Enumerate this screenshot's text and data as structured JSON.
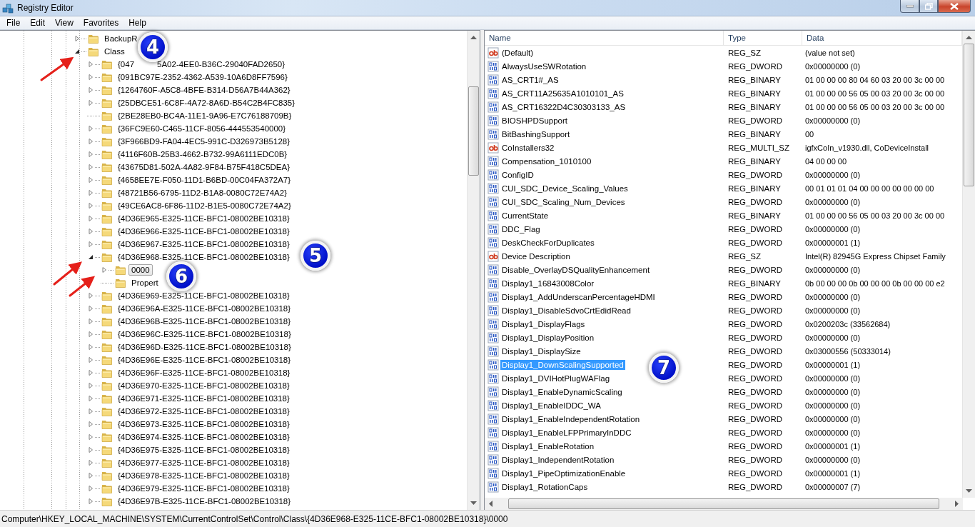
{
  "window": {
    "title": "Registry Editor"
  },
  "menu": [
    "File",
    "Edit",
    "View",
    "Favorites",
    "Help"
  ],
  "tree": {
    "items": [
      {
        "label": "BackupR",
        "has_children": true,
        "expanded": false,
        "selected": false
      },
      {
        "label": "Class",
        "has_children": true,
        "expanded": true,
        "selected": false,
        "children": [
          {
            "label": "{047",
            "label_after": "5A02-4EE0-B36C-29040FAD2650}",
            "has_children": true,
            "expanded": false,
            "selected": false
          },
          {
            "label": "{091BC97E-2352-4362-A539-10A6D8FF7596}",
            "has_children": true,
            "expanded": false,
            "selected": false
          },
          {
            "label": "{1264760F-A5C8-4BFE-B314-D56A7B44A362}",
            "has_children": true,
            "expanded": false,
            "selected": false
          },
          {
            "label": "{25DBCE51-6C8F-4A72-8A6D-B54C2B4FC835}",
            "has_children": true,
            "expanded": false,
            "selected": false
          },
          {
            "label": "{2BE28EB0-BC4A-11E1-9A96-E7C76188709B}",
            "has_children": false,
            "selected": false
          },
          {
            "label": "{36FC9E60-C465-11CF-8056-444553540000}",
            "has_children": true,
            "expanded": false,
            "selected": false
          },
          {
            "label": "{3F966BD9-FA04-4EC5-991C-D326973B5128}",
            "has_children": true,
            "expanded": false,
            "selected": false
          },
          {
            "label": "{4116F60B-25B3-4662-B732-99A6111EDC0B}",
            "has_children": true,
            "expanded": false,
            "selected": false
          },
          {
            "label": "{43675D81-502A-4A82-9F84-B75F418C5DEA}",
            "has_children": true,
            "expanded": false,
            "selected": false
          },
          {
            "label": "{4658EE7E-F050-11D1-B6BD-00C04FA372A7}",
            "has_children": true,
            "expanded": false,
            "selected": false
          },
          {
            "label": "{48721B56-6795-11D2-B1A8-0080C72E74A2}",
            "has_children": true,
            "expanded": false,
            "selected": false
          },
          {
            "label": "{49CE6AC8-6F86-11D2-B1E5-0080C72E74A2}",
            "has_children": true,
            "expanded": false,
            "selected": false
          },
          {
            "label": "{4D36E965-E325-11CE-BFC1-08002BE10318}",
            "has_children": true,
            "expanded": false,
            "selected": false
          },
          {
            "label": "{4D36E966-E325-11CE-BFC1-08002BE10318}",
            "has_children": true,
            "expanded": false,
            "selected": false
          },
          {
            "label": "{4D36E967-E325-11CE-BFC1-08002BE10318}",
            "has_children": true,
            "expanded": false,
            "selected": false
          },
          {
            "label": "{4D36E968-E325-11CE-BFC1-08002BE10318}",
            "has_children": true,
            "expanded": true,
            "selected": false,
            "children": [
              {
                "label": "0000",
                "has_children": true,
                "expanded": false,
                "selected": true
              },
              {
                "label": "Propert",
                "has_children": false,
                "selected": false
              }
            ]
          },
          {
            "label": "{4D36E969-E325-11CE-BFC1-08002BE10318}",
            "has_children": true,
            "expanded": false,
            "selected": false
          },
          {
            "label": "{4D36E96A-E325-11CE-BFC1-08002BE10318}",
            "has_children": true,
            "expanded": false,
            "selected": false
          },
          {
            "label": "{4D36E96B-E325-11CE-BFC1-08002BE10318}",
            "has_children": true,
            "expanded": false,
            "selected": false
          },
          {
            "label": "{4D36E96C-E325-11CE-BFC1-08002BE10318}",
            "has_children": true,
            "expanded": false,
            "selected": false
          },
          {
            "label": "{4D36E96D-E325-11CE-BFC1-08002BE10318}",
            "has_children": true,
            "expanded": false,
            "selected": false
          },
          {
            "label": "{4D36E96E-E325-11CE-BFC1-08002BE10318}",
            "has_children": true,
            "expanded": false,
            "selected": false
          },
          {
            "label": "{4D36E96F-E325-11CE-BFC1-08002BE10318}",
            "has_children": true,
            "expanded": false,
            "selected": false
          },
          {
            "label": "{4D36E970-E325-11CE-BFC1-08002BE10318}",
            "has_children": true,
            "expanded": false,
            "selected": false
          },
          {
            "label": "{4D36E971-E325-11CE-BFC1-08002BE10318}",
            "has_children": true,
            "expanded": false,
            "selected": false
          },
          {
            "label": "{4D36E972-E325-11CE-BFC1-08002BE10318}",
            "has_children": true,
            "expanded": false,
            "selected": false
          },
          {
            "label": "{4D36E973-E325-11CE-BFC1-08002BE10318}",
            "has_children": true,
            "expanded": false,
            "selected": false
          },
          {
            "label": "{4D36E974-E325-11CE-BFC1-08002BE10318}",
            "has_children": true,
            "expanded": false,
            "selected": false
          },
          {
            "label": "{4D36E975-E325-11CE-BFC1-08002BE10318}",
            "has_children": true,
            "expanded": false,
            "selected": false
          },
          {
            "label": "{4D36E977-E325-11CE-BFC1-08002BE10318}",
            "has_children": true,
            "expanded": false,
            "selected": false
          },
          {
            "label": "{4D36E978-E325-11CE-BFC1-08002BE10318}",
            "has_children": true,
            "expanded": false,
            "selected": false
          },
          {
            "label": "{4D36E979-E325-11CE-BFC1-08002BE10318}",
            "has_children": true,
            "expanded": false,
            "selected": false
          },
          {
            "label": "{4D36E97B-E325-11CE-BFC1-08002BE10318}",
            "has_children": true,
            "expanded": false,
            "selected": false
          }
        ]
      }
    ]
  },
  "values": {
    "columns": [
      "Name",
      "Type",
      "Data"
    ],
    "rows": [
      {
        "kind": "string",
        "name": "(Default)",
        "type": "REG_SZ",
        "data": "(value not set)",
        "selected": false
      },
      {
        "kind": "binary",
        "name": "AlwaysUseSWRotation",
        "type": "REG_DWORD",
        "data": "0x00000000 (0)",
        "selected": false
      },
      {
        "kind": "binary",
        "name": "AS_CRT1#_AS",
        "type": "REG_BINARY",
        "data": "01 00 00 00 80 04 60 03 20 00 3c 00 00",
        "selected": false
      },
      {
        "kind": "binary",
        "name": "AS_CRT11A25635A1010101_AS",
        "type": "REG_BINARY",
        "data": "01 00 00 00 56 05 00 03 20 00 3c 00 00",
        "selected": false
      },
      {
        "kind": "binary",
        "name": "AS_CRT16322D4C30303133_AS",
        "type": "REG_BINARY",
        "data": "01 00 00 00 56 05 00 03 20 00 3c 00 00",
        "selected": false
      },
      {
        "kind": "binary",
        "name": "BIOSHPDSupport",
        "type": "REG_DWORD",
        "data": "0x00000000 (0)",
        "selected": false
      },
      {
        "kind": "binary",
        "name": "BitBashingSupport",
        "type": "REG_BINARY",
        "data": "00",
        "selected": false
      },
      {
        "kind": "string",
        "name": "CoInstallers32",
        "type": "REG_MULTI_SZ",
        "data": "igfxCoIn_v1930.dll, CoDeviceInstall",
        "selected": false
      },
      {
        "kind": "binary",
        "name": "Compensation_1010100",
        "type": "REG_BINARY",
        "data": "04 00 00 00",
        "selected": false
      },
      {
        "kind": "binary",
        "name": "ConfigID",
        "type": "REG_DWORD",
        "data": "0x00000000 (0)",
        "selected": false
      },
      {
        "kind": "binary",
        "name": "CUI_SDC_Device_Scaling_Values",
        "type": "REG_BINARY",
        "data": "00 01 01 01 04 00 00 00 00 00 00 00",
        "selected": false
      },
      {
        "kind": "binary",
        "name": "CUI_SDC_Scaling_Num_Devices",
        "type": "REG_DWORD",
        "data": "0x00000000 (0)",
        "selected": false
      },
      {
        "kind": "binary",
        "name": "CurrentState",
        "type": "REG_BINARY",
        "data": "01 00 00 00 56 05 00 03 20 00 3c 00 00",
        "selected": false
      },
      {
        "kind": "binary",
        "name": "DDC_Flag",
        "type": "REG_DWORD",
        "data": "0x00000000 (0)",
        "selected": false
      },
      {
        "kind": "binary",
        "name": "DeskCheckForDuplicates",
        "type": "REG_DWORD",
        "data": "0x00000001 (1)",
        "selected": false
      },
      {
        "kind": "string",
        "name": "Device Description",
        "type": "REG_SZ",
        "data": "Intel(R) 82945G Express Chipset Family",
        "selected": false
      },
      {
        "kind": "binary",
        "name": "Disable_OverlayDSQualityEnhancement",
        "type": "REG_DWORD",
        "data": "0x00000000 (0)",
        "selected": false
      },
      {
        "kind": "binary",
        "name": "Display1_16843008Color",
        "type": "REG_BINARY",
        "data": "0b 00 00 00 0b 00 00 00 0b 00 00 00 e2",
        "selected": false
      },
      {
        "kind": "binary",
        "name": "Display1_AddUnderscanPercentageHDMI",
        "type": "REG_DWORD",
        "data": "0x00000000 (0)",
        "selected": false
      },
      {
        "kind": "binary",
        "name": "Display1_DisableSdvoCrtEdidRead",
        "type": "REG_DWORD",
        "data": "0x00000000 (0)",
        "selected": false
      },
      {
        "kind": "binary",
        "name": "Display1_DisplayFlags",
        "type": "REG_DWORD",
        "data": "0x0200203c (33562684)",
        "selected": false
      },
      {
        "kind": "binary",
        "name": "Display1_DisplayPosition",
        "type": "REG_DWORD",
        "data": "0x00000000 (0)",
        "selected": false
      },
      {
        "kind": "binary",
        "name": "Display1_DisplaySize",
        "type": "REG_DWORD",
        "data": "0x03000556 (50333014)",
        "selected": false
      },
      {
        "kind": "binary",
        "name": "Display1_DownScalingSupported",
        "type": "REG_DWORD",
        "data": "0x00000001 (1)",
        "selected": true
      },
      {
        "kind": "binary",
        "name": "Display1_DVIHotPlugWAFlag",
        "type": "REG_DWORD",
        "data": "0x00000000 (0)",
        "selected": false
      },
      {
        "kind": "binary",
        "name": "Display1_EnableDynamicScaling",
        "type": "REG_DWORD",
        "data": "0x00000000 (0)",
        "selected": false
      },
      {
        "kind": "binary",
        "name": "Display1_EnableIDDC_WA",
        "type": "REG_DWORD",
        "data": "0x00000000 (0)",
        "selected": false
      },
      {
        "kind": "binary",
        "name": "Display1_EnableIndependentRotation",
        "type": "REG_DWORD",
        "data": "0x00000000 (0)",
        "selected": false
      },
      {
        "kind": "binary",
        "name": "Display1_EnableLFPPrimaryInDDC",
        "type": "REG_DWORD",
        "data": "0x00000000 (0)",
        "selected": false
      },
      {
        "kind": "binary",
        "name": "Display1_EnableRotation",
        "type": "REG_DWORD",
        "data": "0x00000001 (1)",
        "selected": false
      },
      {
        "kind": "binary",
        "name": "Display1_IndependentRotation",
        "type": "REG_DWORD",
        "data": "0x00000000 (0)",
        "selected": false
      },
      {
        "kind": "binary",
        "name": "Display1_PipeOptimizationEnable",
        "type": "REG_DWORD",
        "data": "0x00000001 (1)",
        "selected": false
      },
      {
        "kind": "binary",
        "name": "Display1_RotationCaps",
        "type": "REG_DWORD",
        "data": "0x00000007 (7)",
        "selected": false
      }
    ]
  },
  "status_bar": "Computer\\HKEY_LOCAL_MACHINE\\SYSTEM\\CurrentControlSet\\Control\\Class\\{4D36E968-E325-11CE-BFC1-08002BE10318}\\0000",
  "callouts": [
    {
      "label": "4"
    },
    {
      "label": "5"
    },
    {
      "label": "6"
    },
    {
      "label": "7"
    }
  ]
}
